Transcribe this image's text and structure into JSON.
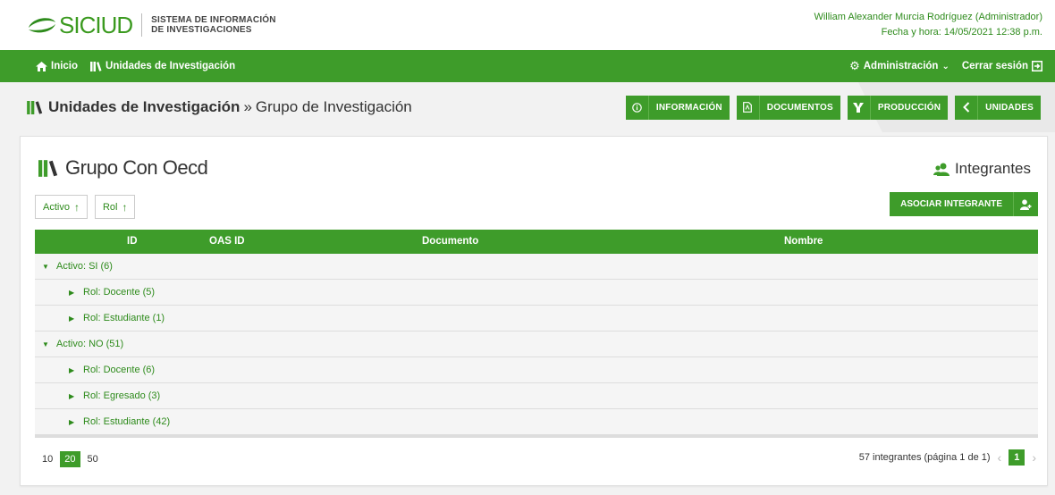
{
  "header": {
    "logo_text": "SICIUD",
    "subtitle_line1": "SISTEMA DE INFORMACIÓN",
    "subtitle_line2": "DE INVESTIGACIONES",
    "user": "William Alexander Murcia Rodríguez (Administrador)",
    "datetime": "Fecha y hora: 14/05/2021 12:38 p.m."
  },
  "nav": {
    "home": "Inicio",
    "units": "Unidades de Investigación",
    "admin": "Administración",
    "logout": "Cerrar sesión"
  },
  "titlebar": {
    "crumb_parent": "Unidades de Investigación",
    "crumb_sep": "»",
    "crumb_current": "Grupo de Investigación",
    "buttons": {
      "info": "INFORMACIÓN",
      "docs": "DOCUMENTOS",
      "prod": "PRODUCCIÓN",
      "units": "UNIDADES"
    }
  },
  "card": {
    "title": "Grupo Con Oecd",
    "section": "Integrantes",
    "filters": [
      "Activo",
      "Rol"
    ],
    "associate": "ASOCIAR INTEGRANTE"
  },
  "table": {
    "columns": [
      "ID",
      "OAS ID",
      "Documento",
      "Nombre"
    ],
    "rows": [
      {
        "level": 1,
        "expanded": true,
        "label": "Activo: SI (6)"
      },
      {
        "level": 2,
        "expanded": false,
        "label": "Rol: Docente (5)"
      },
      {
        "level": 2,
        "expanded": false,
        "label": "Rol: Estudiante (1)"
      },
      {
        "level": 1,
        "expanded": true,
        "label": "Activo: NO (51)"
      },
      {
        "level": 2,
        "expanded": false,
        "label": "Rol: Docente (6)"
      },
      {
        "level": 2,
        "expanded": false,
        "label": "Rol: Egresado (3)"
      },
      {
        "level": 2,
        "expanded": false,
        "label": "Rol: Estudiante (42)"
      }
    ]
  },
  "pager": {
    "sizes": [
      "10",
      "20",
      "50"
    ],
    "active_size": "20",
    "summary": "57 integrantes (página 1 de 1)",
    "page": "1"
  },
  "colors": {
    "brand": "#3e9c2a",
    "link": "#2e8b1c"
  }
}
